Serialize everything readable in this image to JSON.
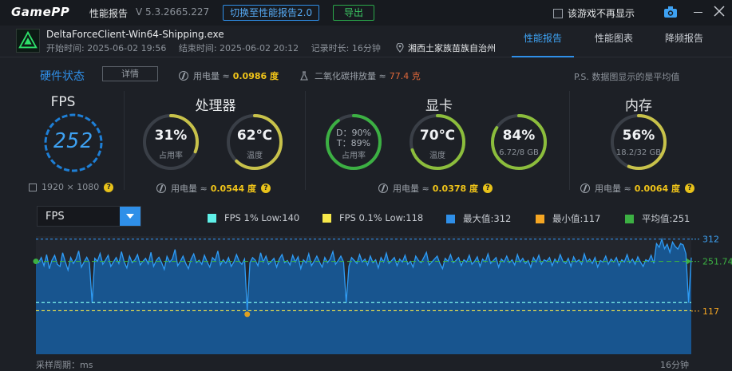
{
  "window": {
    "logo": "GamePP",
    "title": "性能报告",
    "version": "V 5.3.2665.227",
    "switch_button": "切换至性能报告2.0",
    "export_button": "导出",
    "no_more_label": "该游戏不再显示"
  },
  "process": {
    "name": "DeltaForceClient-Win64-Shipping.exe",
    "start": "开始时间: 2025-06-02 19:56",
    "end": "结束时间: 2025-06-02 20:12",
    "duration": "记录时长: 16分钟",
    "location": "湘西土家族苗族自治州"
  },
  "tabs": [
    {
      "label": "性能报告",
      "active": true
    },
    {
      "label": "性能图表",
      "active": false
    },
    {
      "label": "降频报告",
      "active": false
    }
  ],
  "hardware": {
    "title": "硬件状态",
    "detail_button": "详情",
    "power_label": "用电量 ≈",
    "total_power": "0.0986 度",
    "co2_label": "二氧化碳排放量 ≈",
    "co2_value": "77.4 克",
    "note": "P.S. 数据图显示的是平均值"
  },
  "fps": {
    "title": "FPS",
    "value": "252",
    "resolution": "1920 × 1080"
  },
  "cpu": {
    "title": "处理器",
    "usage": {
      "value": "31%",
      "label": "占用率",
      "percent": 31
    },
    "temp": {
      "value": "62℃",
      "label": "温度",
      "percent": 62
    },
    "power": "0.0544 度"
  },
  "gpu": {
    "title": "显卡",
    "usage": {
      "line1": "D：90%",
      "line2": "T：89%",
      "label": "占用率",
      "percent": 90
    },
    "temp": {
      "value": "70℃",
      "label": "温度",
      "percent": 70
    },
    "mem": {
      "value": "84%",
      "label": "6.72/8 GB",
      "percent": 84
    },
    "power": "0.0378 度"
  },
  "ram": {
    "title": "内存",
    "usage": {
      "value": "56%",
      "label": "18.2/32 GB",
      "percent": 56
    },
    "power": "0.0064 度"
  },
  "chart_selector": "FPS",
  "legend": [
    {
      "label": "FPS 1% Low:140",
      "color": "#5ff0e8"
    },
    {
      "label": "FPS 0.1% Low:118",
      "color": "#f6e84a"
    },
    {
      "label": "最大值:312",
      "color": "#2f8fe8"
    },
    {
      "label": "最小值:117",
      "color": "#f5a623"
    },
    {
      "label": "平均值:251",
      "color": "#3cb043"
    }
  ],
  "chart_data": {
    "type": "area",
    "y_max_label": "312",
    "y_avg_label": "251.74",
    "y_min_label": "117",
    "xlabel": "采样周期：ms",
    "x_end_label": "16分钟",
    "max": 312,
    "min": 117,
    "avg": 251.74,
    "low1": 140,
    "low01": 118,
    "ylim": [
      0,
      320
    ],
    "values": [
      251,
      248,
      262,
      240,
      270,
      232,
      255,
      268,
      244,
      238,
      275,
      250,
      228,
      262,
      246,
      258,
      280,
      236,
      250,
      263,
      248,
      140,
      260,
      252,
      273,
      244,
      255,
      268,
      238,
      250,
      262,
      246,
      278,
      250,
      234,
      266,
      248,
      256,
      270,
      242,
      252,
      260,
      245,
      276,
      238,
      254,
      263,
      248,
      230,
      265,
      250,
      258,
      284,
      240,
      252,
      266,
      246,
      232,
      258,
      272,
      248,
      255,
      244,
      268,
      250,
      236,
      262,
      254,
      280,
      242,
      256,
      247,
      262,
      238,
      250,
      270,
      252,
      244,
      258,
      118,
      248,
      262,
      255,
      240,
      275,
      250,
      266,
      244,
      252,
      260,
      236,
      258,
      270,
      248,
      254,
      242,
      268,
      250,
      264,
      232,
      256,
      248,
      272,
      240,
      252,
      266,
      250,
      236,
      262,
      248,
      258,
      278,
      244,
      254,
      266,
      250,
      140,
      238,
      262,
      254,
      246,
      270,
      250,
      258,
      242,
      266,
      248,
      256,
      234,
      262,
      250,
      274,
      246,
      254,
      262,
      240,
      258,
      250,
      268,
      244,
      252,
      236,
      266,
      254,
      248,
      262,
      276,
      242,
      250,
      258,
      266,
      246,
      232,
      260,
      252,
      270,
      248,
      254,
      262,
      240,
      256,
      250,
      268,
      244,
      252,
      264,
      238,
      258,
      250,
      272,
      246,
      254,
      262,
      236,
      258,
      250,
      266,
      248,
      256,
      242,
      270,
      250,
      260,
      246,
      254,
      236,
      262,
      250,
      268,
      244,
      256,
      252,
      262,
      240,
      258,
      248,
      270,
      252,
      246,
      260,
      238,
      264,
      250,
      256,
      244,
      272,
      250,
      258,
      246,
      262,
      236,
      254,
      250,
      266,
      244,
      258,
      250,
      262,
      240,
      256,
      250,
      270,
      248,
      258,
      244,
      264,
      250,
      238,
      256,
      252,
      268,
      246,
      300,
      290,
      312,
      286,
      298,
      276,
      304,
      292,
      285,
      300,
      296,
      272,
      140,
      262
    ]
  }
}
